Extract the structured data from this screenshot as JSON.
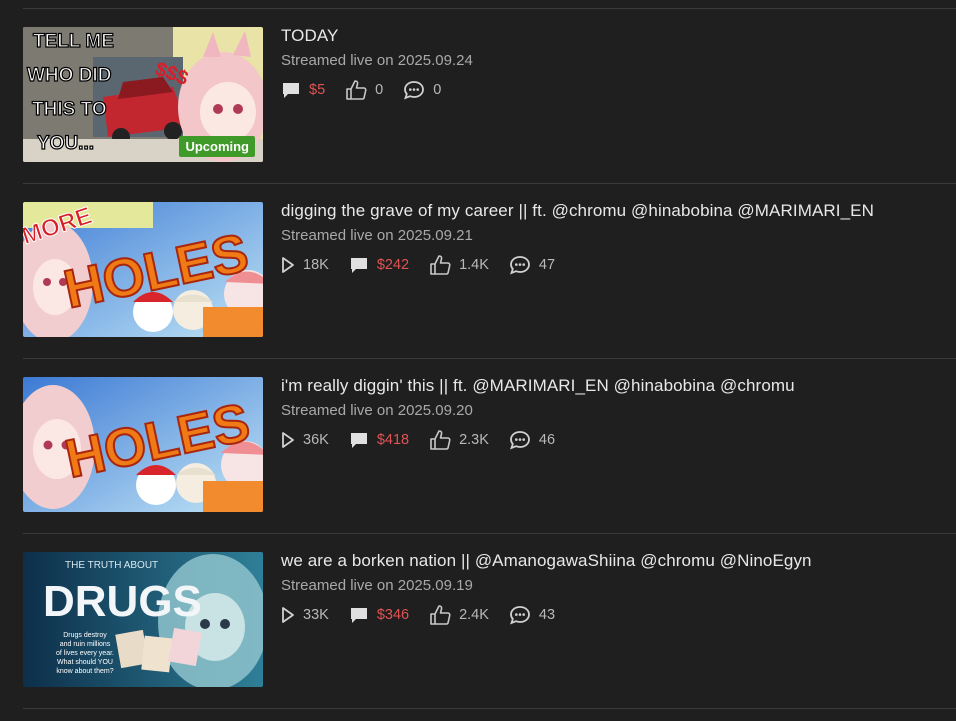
{
  "streams": [
    {
      "title": "TODAY",
      "date": "Streamed live on 2025.09.24",
      "views": null,
      "superchats": "$5",
      "likes": "0",
      "comments": "0",
      "badge": "Upcoming",
      "thumb_text": [
        "TELL ME",
        "WHO DID",
        "THIS TO",
        "YOU..."
      ]
    },
    {
      "title": "digging the grave of my career || ft. @chromu @hinabobina @MARIMARI_EN",
      "date": "Streamed live on 2025.09.21",
      "views": "18K",
      "superchats": "$242",
      "likes": "1.4K",
      "comments": "47",
      "thumb_text": [
        "MORE",
        "HOLES"
      ]
    },
    {
      "title": "i'm really diggin' this || ft. @MARIMARI_EN @hinabobina @chromu",
      "date": "Streamed live on 2025.09.20",
      "views": "36K",
      "superchats": "$418",
      "likes": "2.3K",
      "comments": "46",
      "thumb_text": [
        "HOLES"
      ]
    },
    {
      "title": "we are a borken nation || @AmanogawaShiina @chromu @NinoEgyn",
      "date": "Streamed live on 2025.09.19",
      "views": "33K",
      "superchats": "$346",
      "likes": "2.4K",
      "comments": "43",
      "thumb_text": [
        "THE TRUTH ABOUT",
        "DRUGS",
        "Drugs destroy",
        "and ruin millions",
        "of lives every year.",
        "What should YOU",
        "know about them?"
      ]
    }
  ],
  "colors": {
    "background": "#1f1f1f",
    "money": "#e05353",
    "badge": "#3f9a2a"
  }
}
